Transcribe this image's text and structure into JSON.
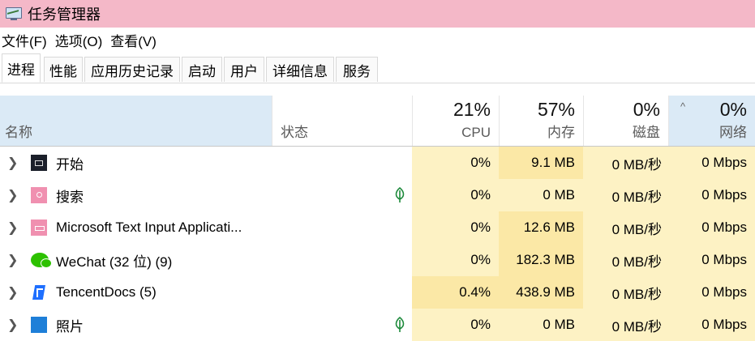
{
  "window": {
    "title": "任务管理器"
  },
  "menu": [
    {
      "label": "文件(F)"
    },
    {
      "label": "选项(O)"
    },
    {
      "label": "查看(V)"
    }
  ],
  "tabs": [
    {
      "label": "进程",
      "active": true
    },
    {
      "label": "性能"
    },
    {
      "label": "应用历史记录"
    },
    {
      "label": "启动"
    },
    {
      "label": "用户"
    },
    {
      "label": "详细信息"
    },
    {
      "label": "服务"
    }
  ],
  "columns": {
    "name": {
      "label": "名称"
    },
    "status": {
      "label": "状态"
    },
    "cpu": {
      "label": "CPU",
      "percent": "21%"
    },
    "memory": {
      "label": "内存",
      "percent": "57%"
    },
    "disk": {
      "label": "磁盘",
      "percent": "0%"
    },
    "network": {
      "label": "网络",
      "percent": "0%",
      "sort_arrow": "^"
    }
  },
  "processes": [
    {
      "name": "开始",
      "icon": "start-menu-icon",
      "status_leaf": false,
      "cpu": "0%",
      "memory": "9.1 MB",
      "disk": "0 MB/秒",
      "network": "0 Mbps",
      "cpu_heat": "#fdf2c4",
      "mem_heat": "#fbe8a6"
    },
    {
      "name": "搜索",
      "icon": "search-app-icon",
      "status_leaf": true,
      "cpu": "0%",
      "memory": "0 MB",
      "disk": "0 MB/秒",
      "network": "0 Mbps",
      "cpu_heat": "#fdf2c4",
      "mem_heat": "#fdf2c4"
    },
    {
      "name": "Microsoft Text Input Applicati...",
      "icon": "text-input-app-icon",
      "status_leaf": false,
      "cpu": "0%",
      "memory": "12.6 MB",
      "disk": "0 MB/秒",
      "network": "0 Mbps",
      "cpu_heat": "#fdf2c4",
      "mem_heat": "#fbe8a6"
    },
    {
      "name": "WeChat (32 位) (9)",
      "icon": "wechat-icon",
      "status_leaf": false,
      "cpu": "0%",
      "memory": "182.3 MB",
      "disk": "0 MB/秒",
      "network": "0 Mbps",
      "cpu_heat": "#fdf2c4",
      "mem_heat": "#fbe8a6"
    },
    {
      "name": "TencentDocs (5)",
      "icon": "tencent-docs-icon",
      "status_leaf": false,
      "cpu": "0.4%",
      "memory": "438.9 MB",
      "disk": "0 MB/秒",
      "network": "0 Mbps",
      "cpu_heat": "#fbe8a6",
      "mem_heat": "#fbe8a6"
    },
    {
      "name": "照片",
      "icon": "photos-icon",
      "status_leaf": true,
      "cpu": "0%",
      "memory": "0 MB",
      "disk": "0 MB/秒",
      "network": "0 Mbps",
      "cpu_heat": "#fdf2c4",
      "mem_heat": "#fdf2c4"
    }
  ],
  "colors": {
    "titlebar": "#f4b8c8",
    "header_selected": "#dbeaf6",
    "heat_light": "#fdf2c4",
    "heat_medium": "#fbe8a6",
    "leaf_green": "#1e8a3c"
  }
}
